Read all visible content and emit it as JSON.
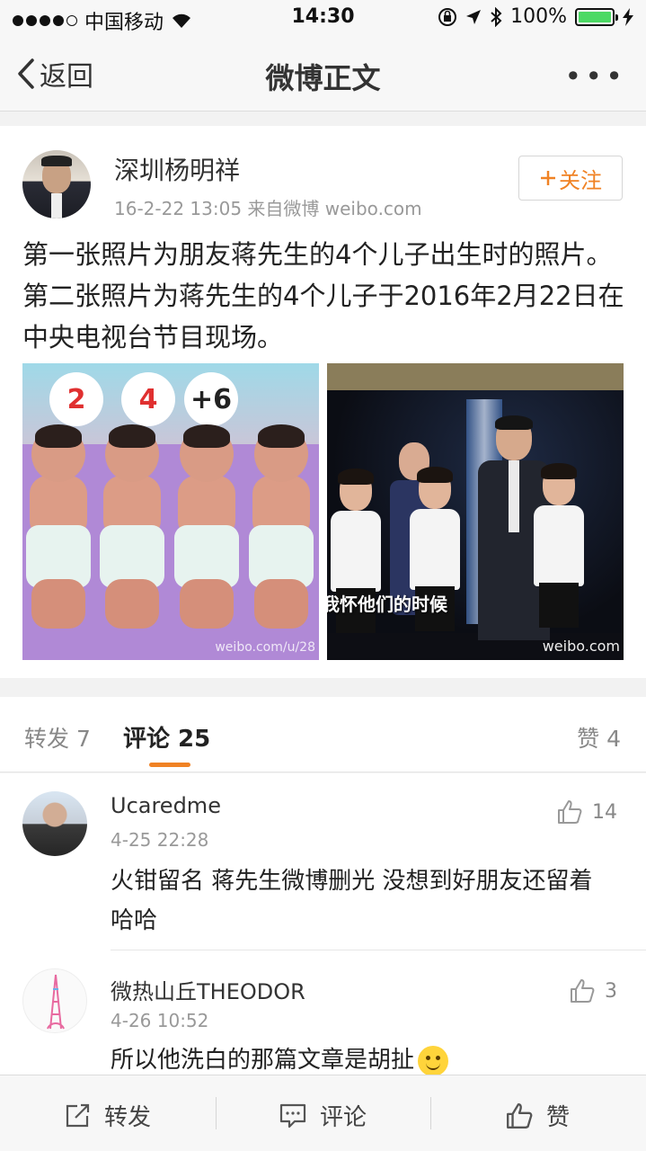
{
  "status_bar": {
    "carrier": "中国移动",
    "time": "14:30",
    "battery": "100%"
  },
  "nav": {
    "back_label": "返回",
    "title": "微博正文"
  },
  "post": {
    "author": "深圳杨明祥",
    "meta": "16-2-22 13:05  来自微博 weibo.com",
    "follow_label": "关注",
    "text": "第一张照片为朋友蒋先生的4个儿子出生时的照片。第二张照片为蒋先生的4个儿子于2016年2月22日在中央电视台节目现场。",
    "photo1": {
      "numbers": [
        "2",
        "4",
        "+6"
      ],
      "watermark": "weibo.com/u/28"
    },
    "photo2": {
      "subtitle": "我怀他们的时候",
      "watermark": "weibo.com"
    }
  },
  "tabs": {
    "repost": "转发 7",
    "comment": "评论 25",
    "like": "赞 4"
  },
  "comments": [
    {
      "user": "Ucaredme",
      "time": "4-25 22:28",
      "text": "火钳留名 蒋先生微博删光 没想到好朋友还留着 哈哈",
      "likes": "14"
    },
    {
      "user": "微热山丘THEODOR",
      "time": "4-26 10:52",
      "text": "所以他洗白的那篇文章是胡扯",
      "likes": "3"
    }
  ],
  "bottom_bar": {
    "repost_label": "转发",
    "comment_label": "评论",
    "like_label": "赞"
  },
  "colors": {
    "accent": "#f08224",
    "battery": "#4cd964"
  }
}
